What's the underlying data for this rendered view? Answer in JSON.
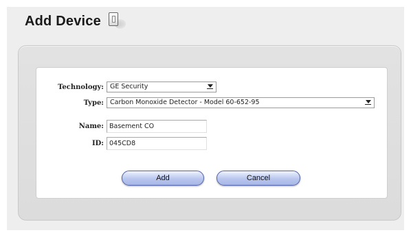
{
  "page": {
    "title": "Add Device",
    "icon": "device-icon"
  },
  "form": {
    "technology": {
      "label": "Technology:",
      "selected": "GE Security"
    },
    "type": {
      "label": "Type:",
      "selected": "Carbon Monoxide Detector - Model 60-652-95"
    },
    "name": {
      "label": "Name:",
      "value": "Basement CO"
    },
    "id": {
      "label": "ID:",
      "value": "045CD8"
    },
    "add_label": "Add",
    "cancel_label": "Cancel"
  },
  "colors": {
    "button_fill": "#b9c6ee",
    "button_border": "#5566aa",
    "panel_bg": "#dcdcdc"
  }
}
